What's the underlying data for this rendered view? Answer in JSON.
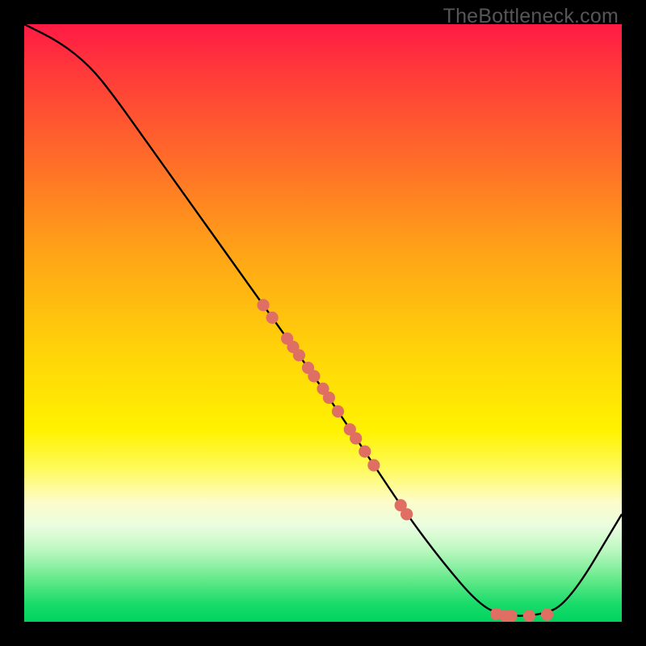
{
  "watermark": "TheBottleneck.com",
  "colors": {
    "curve": "#000000",
    "marker_fill": "#df6e63",
    "marker_stroke": "#a84a41"
  },
  "chart_data": {
    "type": "line",
    "title": "",
    "xlabel": "",
    "ylabel": "",
    "xlim": [
      0,
      100
    ],
    "ylim": [
      0,
      100
    ],
    "curve": {
      "x": [
        0,
        6,
        11,
        15,
        20,
        30,
        40,
        50,
        58,
        64,
        70,
        76,
        80,
        86,
        91,
        100
      ],
      "y": [
        100,
        97,
        93,
        88,
        81,
        67,
        53,
        39,
        27,
        18,
        10,
        3,
        1,
        1,
        3,
        18
      ]
    },
    "markers": {
      "on_curve": [
        {
          "x": 40.0,
          "y": 53.0
        },
        {
          "x": 41.5,
          "y": 50.9
        },
        {
          "x": 44.0,
          "y": 47.4
        },
        {
          "x": 45.0,
          "y": 46.0
        },
        {
          "x": 46.0,
          "y": 44.6
        },
        {
          "x": 47.5,
          "y": 42.5
        },
        {
          "x": 48.5,
          "y": 41.1
        },
        {
          "x": 50.0,
          "y": 39.0
        },
        {
          "x": 51.0,
          "y": 37.5
        },
        {
          "x": 52.5,
          "y": 35.2
        },
        {
          "x": 54.5,
          "y": 32.2
        },
        {
          "x": 55.5,
          "y": 30.7
        },
        {
          "x": 57.0,
          "y": 28.5
        },
        {
          "x": 58.5,
          "y": 26.2
        },
        {
          "x": 63.0,
          "y": 19.5
        },
        {
          "x": 64.0,
          "y": 18.0
        }
      ],
      "bottom": [
        {
          "x": 79.0,
          "y": 1.3
        },
        {
          "x": 80.5,
          "y": 1.0
        },
        {
          "x": 81.5,
          "y": 1.0
        },
        {
          "x": 84.5,
          "y": 1.0
        },
        {
          "x": 87.5,
          "y": 1.2
        }
      ]
    }
  }
}
